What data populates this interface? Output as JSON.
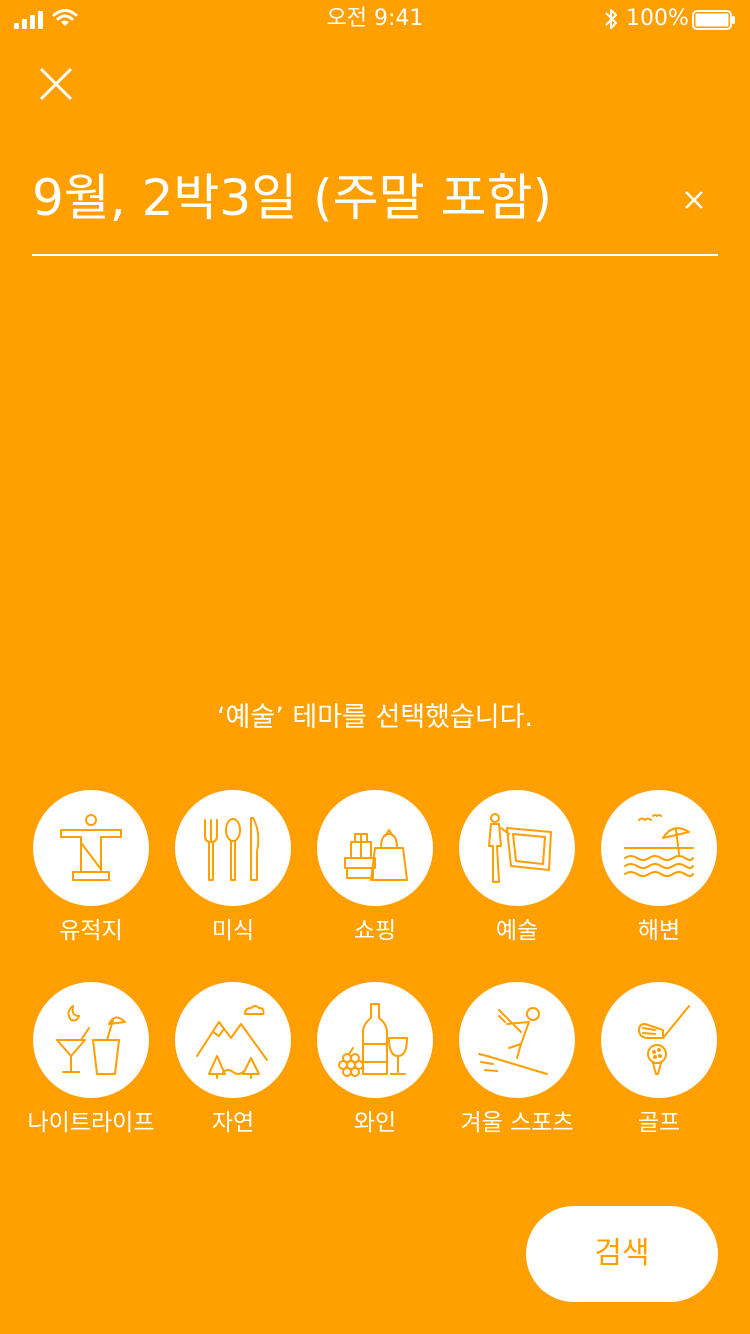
{
  "status_bar": {
    "time": "오전 9:41",
    "battery_percent": "100%",
    "battery_level": 1.0
  },
  "search": {
    "date_text": "9월, 2박3일 (주말 포함)"
  },
  "message": "‘예술’ 테마를 선택했습니다.",
  "themes": [
    {
      "label": "유적지",
      "icon": "statue-icon"
    },
    {
      "label": "미식",
      "icon": "cutlery-icon"
    },
    {
      "label": "쇼핑",
      "icon": "shopping-icon"
    },
    {
      "label": "예술",
      "icon": "art-icon"
    },
    {
      "label": "해변",
      "icon": "beach-icon"
    },
    {
      "label": "나이트라이프",
      "icon": "cocktail-icon"
    },
    {
      "label": "자연",
      "icon": "mountain-icon"
    },
    {
      "label": "와인",
      "icon": "wine-icon"
    },
    {
      "label": "겨울 스포츠",
      "icon": "ski-icon"
    },
    {
      "label": "골프",
      "icon": "golf-icon"
    }
  ],
  "search_button_label": "검색",
  "colors": {
    "background": "#FF9F00",
    "foreground": "#FFFFFF",
    "icon_stroke": "#FF9F00"
  }
}
